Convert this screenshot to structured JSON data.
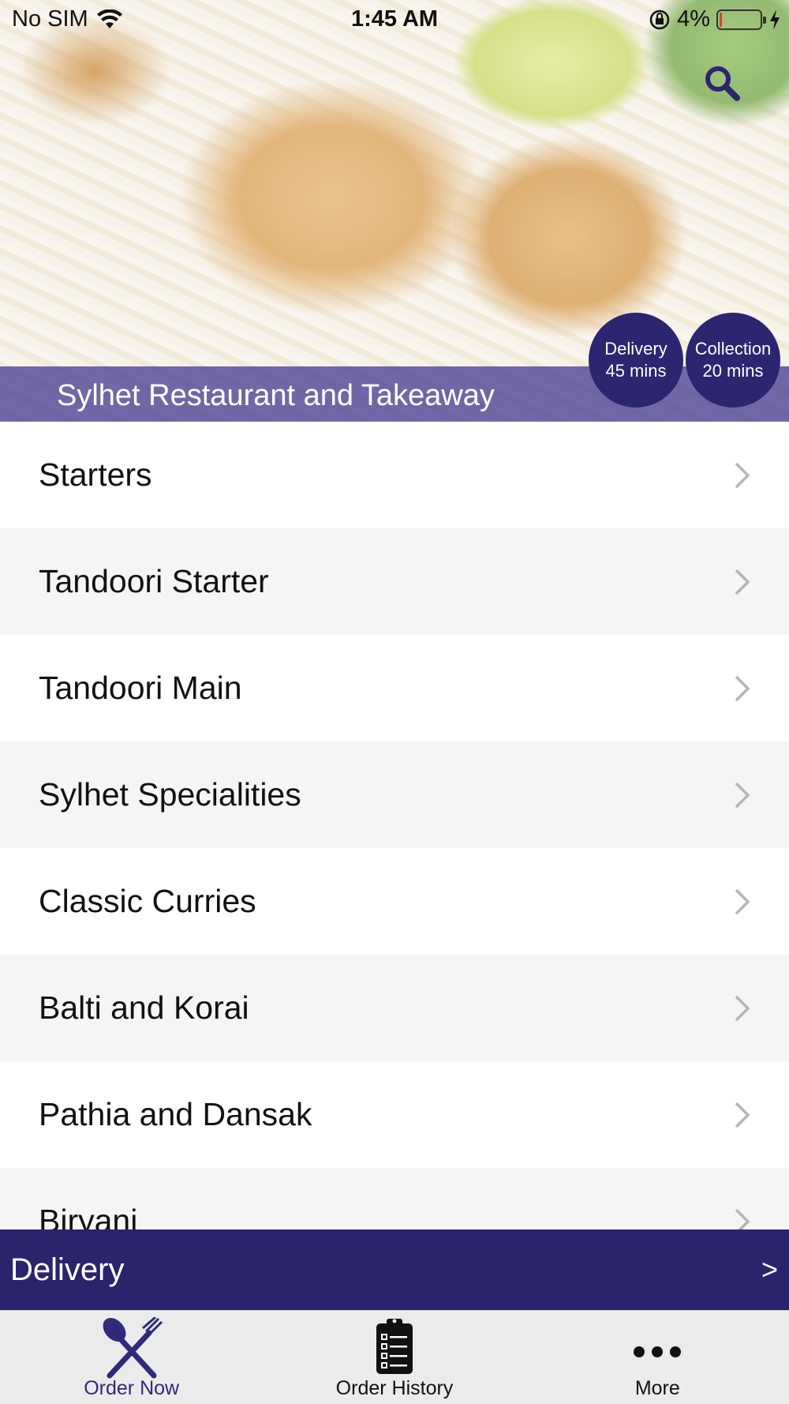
{
  "status_bar": {
    "carrier": "No SIM",
    "time": "1:45 AM",
    "battery_percent": "4%",
    "battery_level": 0.04
  },
  "header": {
    "restaurant_name": "Sylhet Restaurant and Takeaway",
    "search_icon": "search-icon",
    "delivery_badge": {
      "label": "Delivery",
      "time": "45 mins"
    },
    "collection_badge": {
      "label": "Collection",
      "time": "20 mins"
    }
  },
  "menu": {
    "categories": [
      {
        "label": "Starters"
      },
      {
        "label": "Tandoori Starter"
      },
      {
        "label": "Tandoori Main"
      },
      {
        "label": "Sylhet Specialities"
      },
      {
        "label": "Classic Curries"
      },
      {
        "label": "Balti and Korai"
      },
      {
        "label": "Pathia and Dansak"
      },
      {
        "label": "Biryani"
      }
    ]
  },
  "order_mode_bar": {
    "label": "Delivery",
    "arrow": ">"
  },
  "tab_bar": {
    "tabs": [
      {
        "label": "Order Now",
        "icon": "fork-knife-icon",
        "active": true
      },
      {
        "label": "Order History",
        "icon": "clipboard-list-icon",
        "active": false
      },
      {
        "label": "More",
        "icon": "more-dots-icon",
        "active": false
      }
    ]
  },
  "colors": {
    "brand": "#29246b",
    "badge": "#2c2570",
    "active_tab": "#2f2a7a",
    "alt_row": "#f5f5f5"
  }
}
